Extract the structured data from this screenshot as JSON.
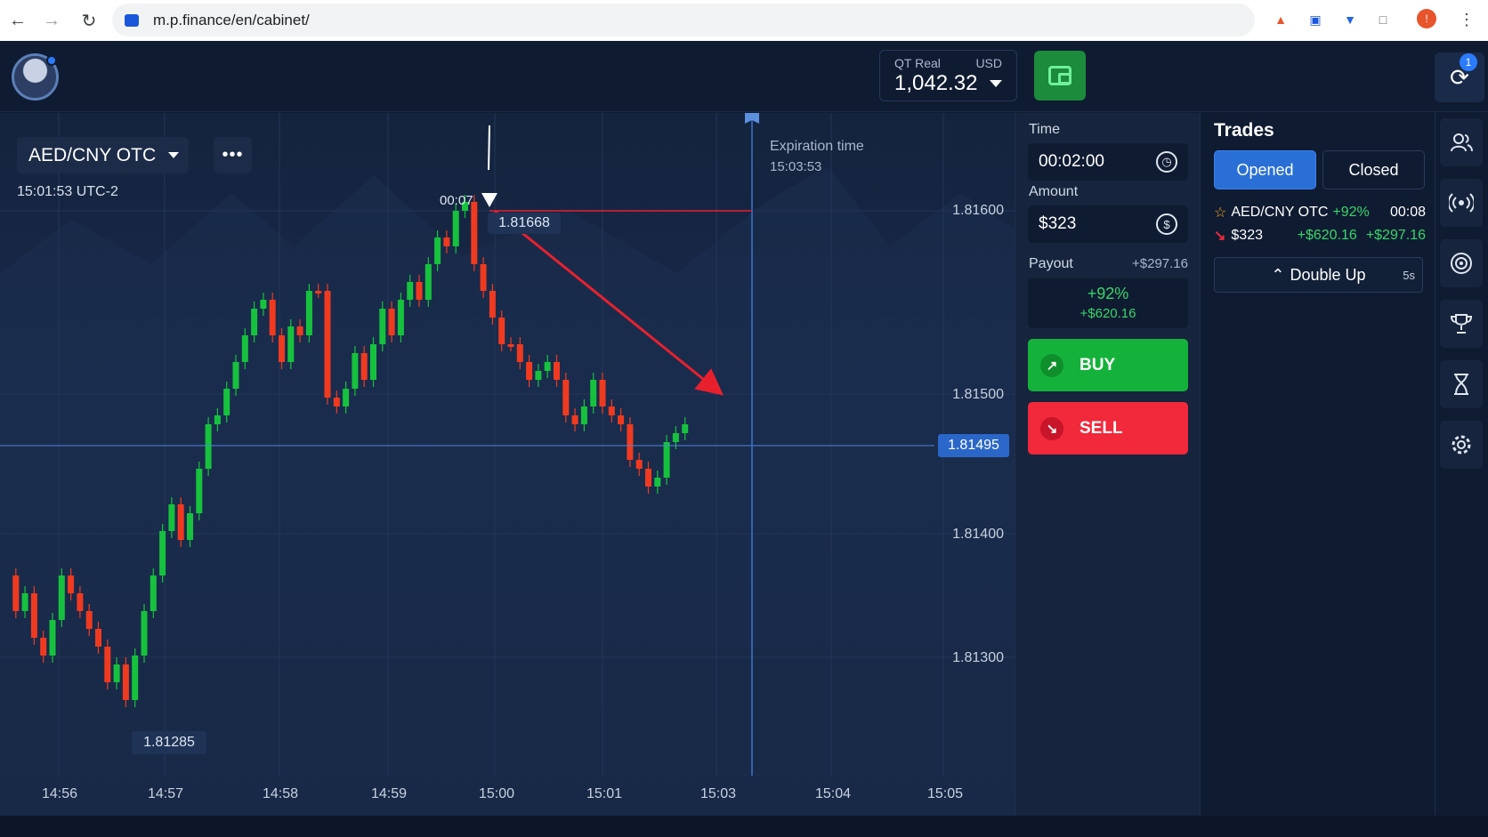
{
  "browser": {
    "url": "m.p.finance/en/cabinet/",
    "back_icon": "arrow-left-icon",
    "forward_icon": "arrow-right-icon",
    "reload_icon": "reload-icon"
  },
  "header": {
    "account_label": "QT Real",
    "currency": "USD",
    "balance": "1,042.32",
    "notifications_count": "1"
  },
  "chart": {
    "pair": "AED/CNY OTC",
    "more_label": "•••",
    "clock": "15:01:53 UTC-2",
    "expiration_label": "Expiration time",
    "expiration_time": "15:03:53",
    "current_price": "1.81495",
    "high_tag": "1.81668",
    "high_timer": "00:07",
    "low_tag": "1.81285",
    "price_labels": [
      "1.81600",
      "1.81500",
      "1.81400",
      "1.81300"
    ],
    "time_labels": [
      "14:56",
      "14:57",
      "14:58",
      "14:59",
      "15:00",
      "15:01",
      "15:03",
      "15:04",
      "15:05"
    ],
    "colors": {
      "up": "#16c23d",
      "down": "#f03a20",
      "line": "#e8202e"
    }
  },
  "trade_panel": {
    "time_label": "Time",
    "time_value": "00:02:00",
    "amount_label": "Amount",
    "amount_value": "$323",
    "payout_label": "Payout",
    "payout_amount": "+$297.16",
    "payout_pct": "+92%",
    "payout_value": "+$620.16",
    "buy_label": "BUY",
    "sell_label": "SELL"
  },
  "trades": {
    "title": "Trades",
    "tab_opened": "Opened",
    "tab_closed": "Closed",
    "row_pair": "AED/CNY OTC",
    "row_pct": "+92%",
    "row_timer": "00:08",
    "row_amount": "$323",
    "row_payout": "+$620.16",
    "row_profit": "+$297.16",
    "double_up_label": "Double Up",
    "double_up_timer": "5s"
  },
  "rail": {
    "items": [
      "users-icon",
      "signals-icon",
      "target-icon",
      "trophy-icon",
      "hourglass-icon",
      "gear-icon"
    ]
  }
}
